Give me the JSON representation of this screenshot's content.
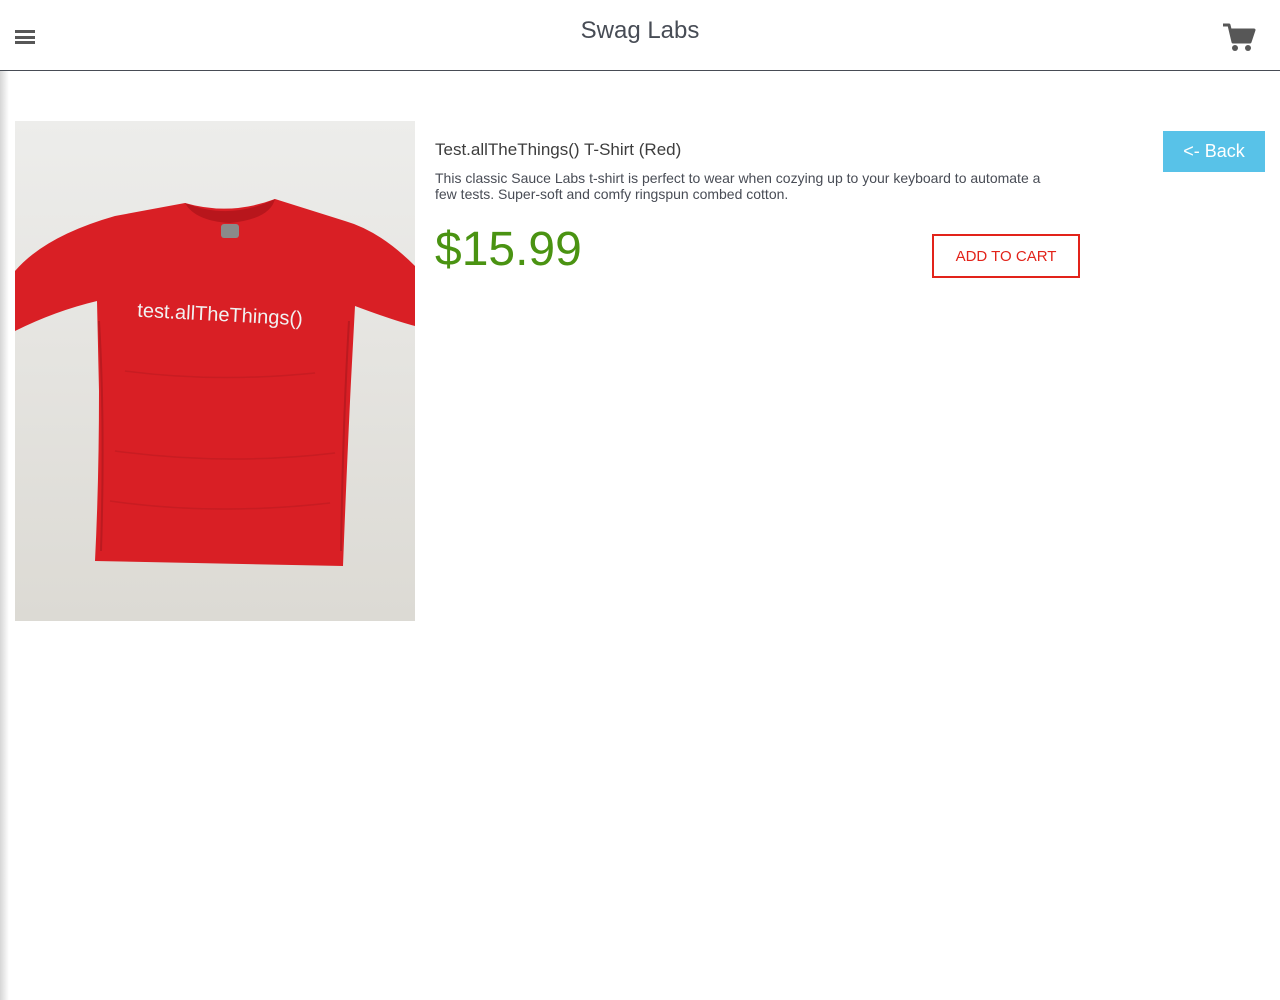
{
  "header": {
    "title": "Swag Labs",
    "menu_icon": "hamburger-menu-icon",
    "cart_icon": "shopping-cart-icon"
  },
  "product": {
    "image_text": "test.allTheThings()",
    "name": "Test.allTheThings() T-Shirt (Red)",
    "description": "This classic Sauce Labs t-shirt is perfect to wear when cozying up to your keyboard to automate a few tests. Super-soft and comfy ringspun combed cotton.",
    "price": "$15.99",
    "add_to_cart_label": "ADD TO CART",
    "back_label": "<- Back"
  },
  "colors": {
    "price_green": "#4a9312",
    "cart_red": "#e2231a",
    "back_blue": "#58c2e8",
    "shirt_red": "#d91f25"
  }
}
